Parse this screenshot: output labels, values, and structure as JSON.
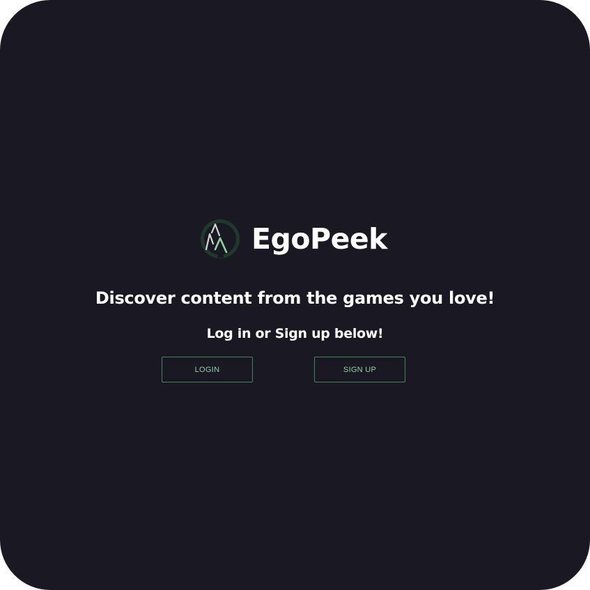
{
  "brand": {
    "name": "EgoPeek",
    "logo_icon": "mountain-peak-logo-icon"
  },
  "hero": {
    "tagline": "Discover content from the games you love!",
    "subtitle": "Log in or Sign up below!"
  },
  "auth": {
    "login_label": "LOGIN",
    "signup_label": "SIGN UP"
  },
  "colors": {
    "background": "#1a1923",
    "accent": "#3f8a55",
    "button_text": "#8fd4a0",
    "text": "#ffffff"
  }
}
